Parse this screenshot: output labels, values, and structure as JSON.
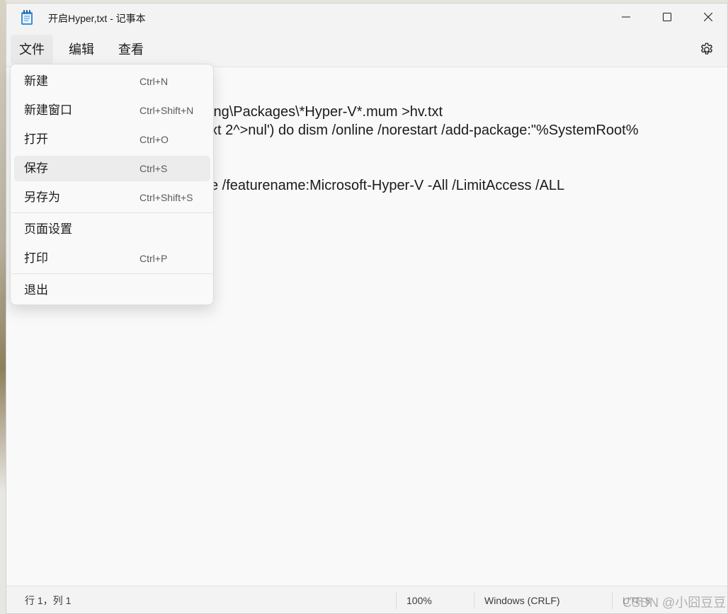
{
  "window": {
    "title": "开启Hyper,txt - 记事本",
    "icon": "notepad-icon"
  },
  "menubar": {
    "items": [
      {
        "label": "文件",
        "active": true
      },
      {
        "label": "编辑",
        "active": false
      },
      {
        "label": "查看",
        "active": false
      }
    ],
    "settings_icon": "gear-icon"
  },
  "file_menu": {
    "items": [
      {
        "label": "新建",
        "shortcut": "Ctrl+N"
      },
      {
        "label": "新建窗口",
        "shortcut": "Ctrl+Shift+N"
      },
      {
        "label": "打开",
        "shortcut": "Ctrl+O"
      },
      {
        "label": "保存",
        "shortcut": "Ctrl+S"
      },
      {
        "label": "另存为",
        "shortcut": "Ctrl+Shift+S"
      },
      {
        "label": "页面设置",
        "shortcut": ""
      },
      {
        "label": "打印",
        "shortcut": "Ctrl+P"
      },
      {
        "label": "退出",
        "shortcut": ""
      }
    ],
    "hovered_item": "保存"
  },
  "editor": {
    "lines": [
      "ing\\Packages\\*Hyper-V*.mum >hv.txt",
      "xt 2^>nul') do dism /online /norestart /add-package:\"%SystemRoot%",
      "e /featurename:Microsoft-Hyper-V -All /LimitAccess /ALL"
    ]
  },
  "statusbar": {
    "position": "行 1，列 1",
    "zoom": "100%",
    "line_ending": "Windows (CRLF)",
    "encoding": "UTF-8"
  },
  "watermark": "CSDN @小囧豆豆",
  "colors": {
    "window_bg": "#f9f9f9",
    "titlebar_bg": "#f3f3f3",
    "hover_bg": "#ececec",
    "icon_blue": "#1a73c8"
  }
}
